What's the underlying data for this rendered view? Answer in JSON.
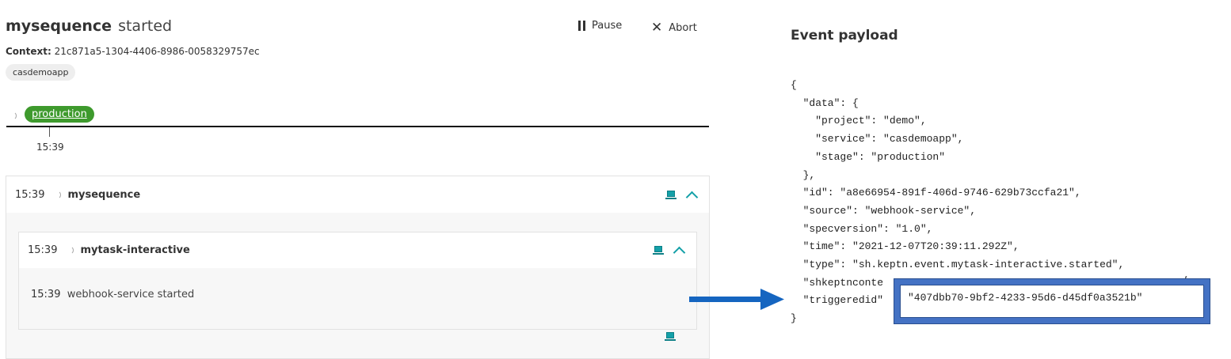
{
  "sequence": {
    "name": "mysequence",
    "state": "started",
    "context_label": "Context:",
    "context_id": "21c871a5-1304-4406-8986-0058329757ec",
    "service_chip": "casdemoapp",
    "stage": "production",
    "stage_time": "15:39",
    "stage_color": "#3e9a2d"
  },
  "actions": {
    "pause": "Pause",
    "abort": "Abort"
  },
  "tree": {
    "sequence_row": {
      "time": "15:39",
      "name": "mysequence"
    },
    "task_row": {
      "time": "15:39",
      "name": "mytask-interactive"
    },
    "event_row": {
      "time": "15:39",
      "text": "webhook-service started"
    }
  },
  "payload": {
    "title": "Event payload",
    "lines": [
      "{",
      "  \"data\": {",
      "    \"project\": \"demo\",",
      "    \"service\": \"casdemoapp\",",
      "    \"stage\": \"production\"",
      "  },",
      "  \"id\": \"a8e66954-891f-406d-9746-629b73ccfa21\",",
      "  \"source\": \"webhook-service\",",
      "  \"specversion\": \"1.0\",",
      "  \"time\": \"2021-12-07T20:39:11.292Z\",",
      "  \"type\": \"sh.keptn.event.mytask-interactive.started\",",
      "  \"shkeptnconte",
      "  \"triggeredid\"",
      "}"
    ],
    "highlight_value": "\"407dbb70-9bf2-4233-95d6-d45df0a3521b\"",
    "highlight_color": "#4472c4",
    "arrow_color": "#1565c0"
  }
}
